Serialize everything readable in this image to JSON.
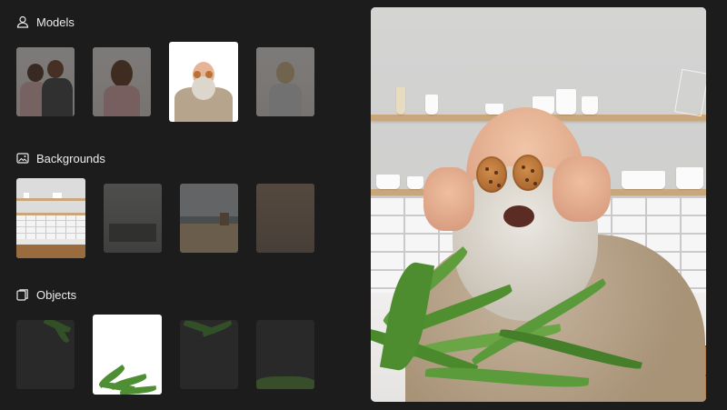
{
  "sections": {
    "models": {
      "title": "Models",
      "icon": "user-icon"
    },
    "backgrounds": {
      "title": "Backgrounds",
      "icon": "image-icon"
    },
    "objects": {
      "title": "Objects",
      "icon": "layers-icon"
    }
  },
  "models": [
    {
      "name": "couple",
      "selected": false
    },
    {
      "name": "woman-long-hair",
      "selected": false
    },
    {
      "name": "bearded-man-cookies",
      "selected": true
    },
    {
      "name": "woman-bun",
      "selected": false
    }
  ],
  "backgrounds": [
    {
      "name": "kitchen",
      "selected": true
    },
    {
      "name": "dining-room",
      "selected": false
    },
    {
      "name": "beach",
      "selected": false
    },
    {
      "name": "brown-interior",
      "selected": false
    }
  ],
  "objects": [
    {
      "name": "palm-top-right",
      "selected": false
    },
    {
      "name": "palm-bottom",
      "selected": true
    },
    {
      "name": "palm-top",
      "selected": false
    },
    {
      "name": "plant-bottom",
      "selected": false
    }
  ],
  "colors": {
    "app_background": "#1c1c1d",
    "selected_thumb": "#ffffff",
    "unselected_thumb": "#3a3a3b"
  }
}
